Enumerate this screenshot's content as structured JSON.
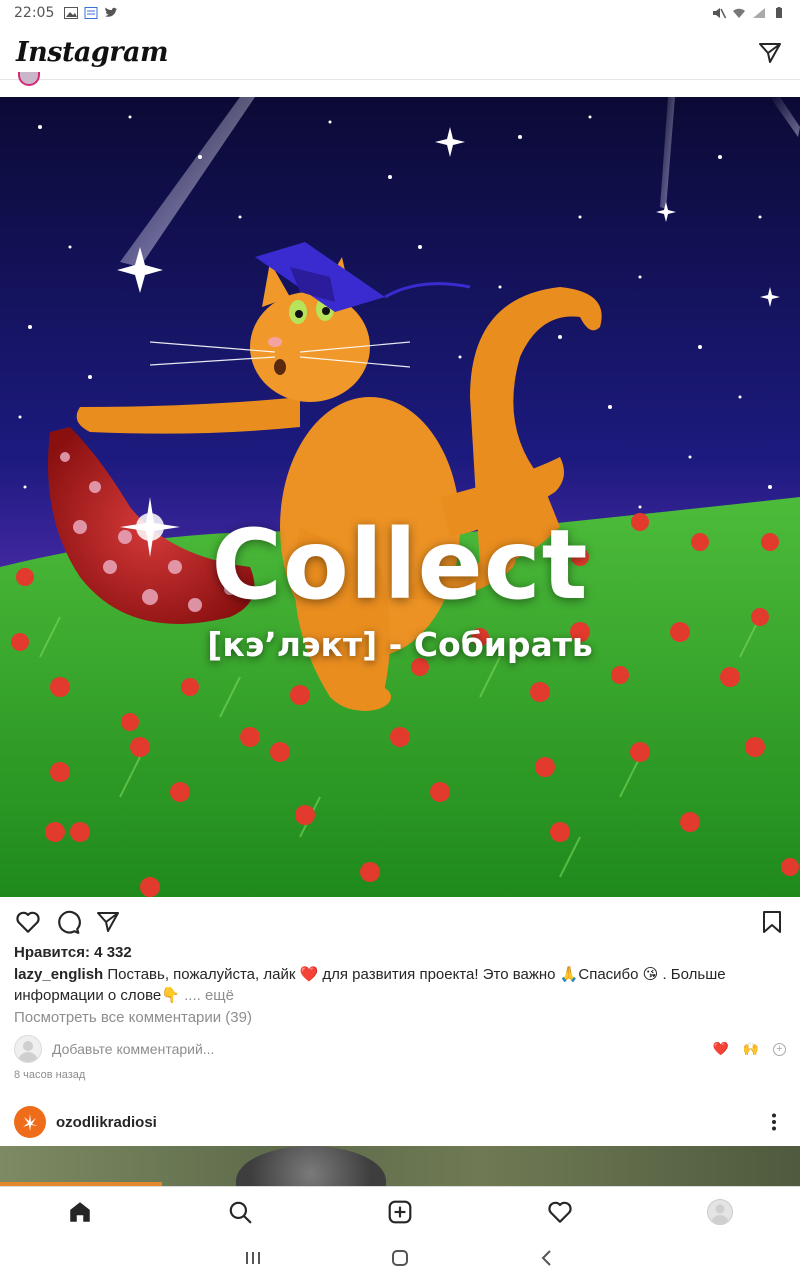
{
  "status_bar": {
    "time": "22:05"
  },
  "app_bar": {
    "logo": "Instagram"
  },
  "post": {
    "overlay_word": "Collect",
    "overlay_sub": "[кэ’лэкт] - Собирать",
    "likes": "Нравится: 4 332",
    "caption": {
      "username": "lazy_english",
      "text": "Поставь, пожалуйста, лайк ❤️ для развития проекта! Это важно 🙏Спасибо 😘 . Больше информации о слове👇",
      "more": ".... ещё"
    },
    "view_comments": "Посмотреть все комментарии (39)",
    "add_comment_placeholder": "Добавьте комментарий...",
    "quick_reactions": [
      "❤️",
      "🙌"
    ],
    "time_ago": "8 часов назад"
  },
  "next_post": {
    "username": "ozodlikradiosi"
  },
  "colors": {
    "brand_orange": "#ef6c1a",
    "like_red": "#ed4956",
    "muted": "#8e8e8e"
  }
}
